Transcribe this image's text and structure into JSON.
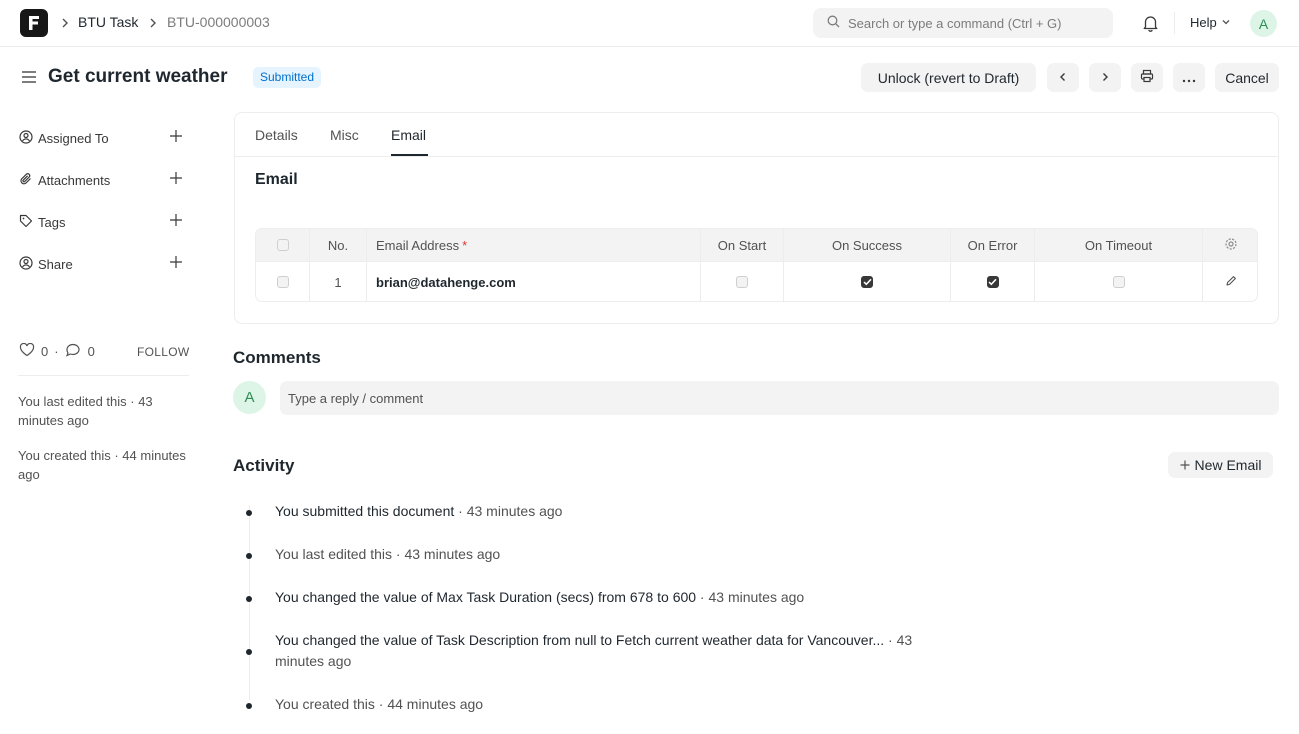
{
  "navbar": {
    "breadcrumbs": [
      "BTU Task",
      "BTU-000000003"
    ],
    "search_placeholder": "Search or type a command (Ctrl + G)",
    "help_label": "Help",
    "avatar_initial": "A"
  },
  "page": {
    "title": "Get current weather",
    "status": "Submitted",
    "unlock_label": "Unlock (revert to Draft)",
    "cancel_label": "Cancel"
  },
  "sidebar": {
    "items": [
      {
        "label": "Assigned To"
      },
      {
        "label": "Attachments"
      },
      {
        "label": "Tags"
      },
      {
        "label": "Share"
      }
    ],
    "likes": "0",
    "comments": "0",
    "follow_label": "FOLLOW",
    "last_edited": "You last edited this · 43 minutes ago",
    "created": "You created this · 44 minutes ago"
  },
  "form": {
    "tabs": [
      "Details",
      "Misc",
      "Email"
    ],
    "active_tab": "Email",
    "section_title": "Email",
    "table": {
      "columns": [
        "No.",
        "Email Address",
        "On Start",
        "On Success",
        "On Error",
        "On Timeout"
      ],
      "rows": [
        {
          "no": "1",
          "email": "brian@datahenge.com",
          "on_start": false,
          "on_success": true,
          "on_error": true,
          "on_timeout": false
        }
      ]
    }
  },
  "comments": {
    "title": "Comments",
    "avatar_initial": "A",
    "placeholder": "Type a reply / comment"
  },
  "activity": {
    "title": "Activity",
    "new_email_label": "New Email",
    "items": [
      {
        "pre": "You submitted this document",
        "time": " · 43 minutes ago"
      },
      {
        "pre": "You last edited this",
        "time": " · 43 minutes ago"
      },
      {
        "pre": "You changed the value of Max Task Duration (secs) from ",
        "v1": "678",
        "mid": " to ",
        "v2": "600",
        "time": " · 43 minutes ago"
      },
      {
        "pre": "You changed the value of Task Description from ",
        "v1": "null",
        "mid": " to ",
        "v2": "Fetch current weather data for Vancouver...",
        "time": " · 43 minutes ago"
      },
      {
        "pre": "You created this",
        "time": " · 44 minutes ago"
      }
    ]
  },
  "colors": {
    "accent": "#1f272e",
    "badge_bg": "#e6f4ff",
    "badge_text": "#0070cc",
    "avatar_bg": "#dcf5e7"
  }
}
